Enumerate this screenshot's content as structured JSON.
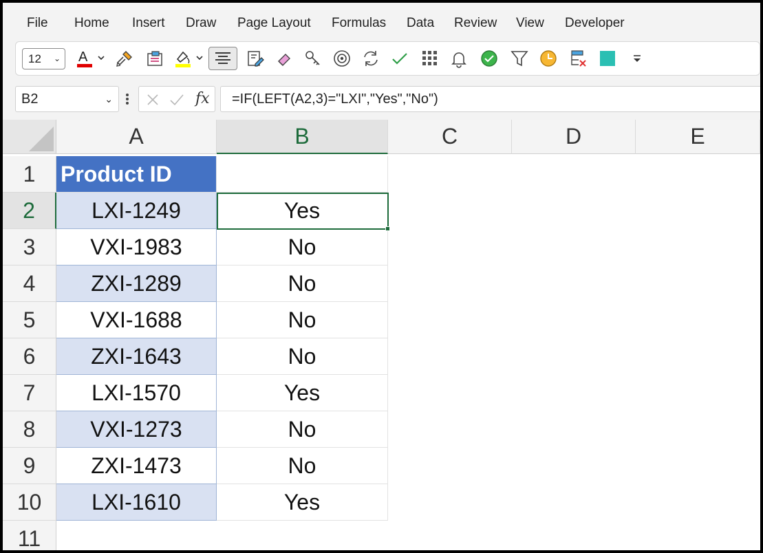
{
  "menu": [
    "File",
    "Home",
    "Insert",
    "Draw",
    "Page Layout",
    "Formulas",
    "Data",
    "Review",
    "View",
    "Developer"
  ],
  "toolbar": {
    "font_size": "12",
    "font_color": "#e00000",
    "highlight_color": "#ffff00",
    "fill_square_color": "#2bbfb3",
    "icons": [
      "font-color-icon",
      "format-painter-icon",
      "object-icon",
      "highlight-icon",
      "align-center-icon",
      "form-icon",
      "eraser-icon",
      "key-icon",
      "target-icon",
      "refresh-icon",
      "checkmark-icon",
      "grid-icon",
      "bell-icon",
      "check-circle-icon",
      "filter-icon",
      "clock-icon",
      "clear-format-icon",
      "fill-square-icon",
      "customize-toolbar-icon"
    ]
  },
  "formula_bar": {
    "name_box": "B2",
    "fx_label": "fx",
    "formula": "=IF(LEFT(A2,3)=\"LXI\",\"Yes\",\"No\")"
  },
  "grid": {
    "columns": [
      "A",
      "B",
      "C",
      "D",
      "E"
    ],
    "rows": [
      "1",
      "2",
      "3",
      "4",
      "5",
      "6",
      "7",
      "8",
      "9",
      "10",
      "11"
    ],
    "header_cell": "Product ID",
    "product_ids": [
      "LXI-1249",
      "VXI-1983",
      "ZXI-1289",
      "VXI-1688",
      "ZXI-1643",
      "LXI-1570",
      "VXI-1273",
      "ZXI-1473",
      "LXI-1610"
    ],
    "results": [
      "Yes",
      "No",
      "No",
      "No",
      "No",
      "Yes",
      "No",
      "No",
      "Yes"
    ],
    "selected_cell": "B2",
    "header_fill": "#4472c4",
    "band_fill": "#d9e1f2",
    "selection_color": "#1d6b3b"
  }
}
